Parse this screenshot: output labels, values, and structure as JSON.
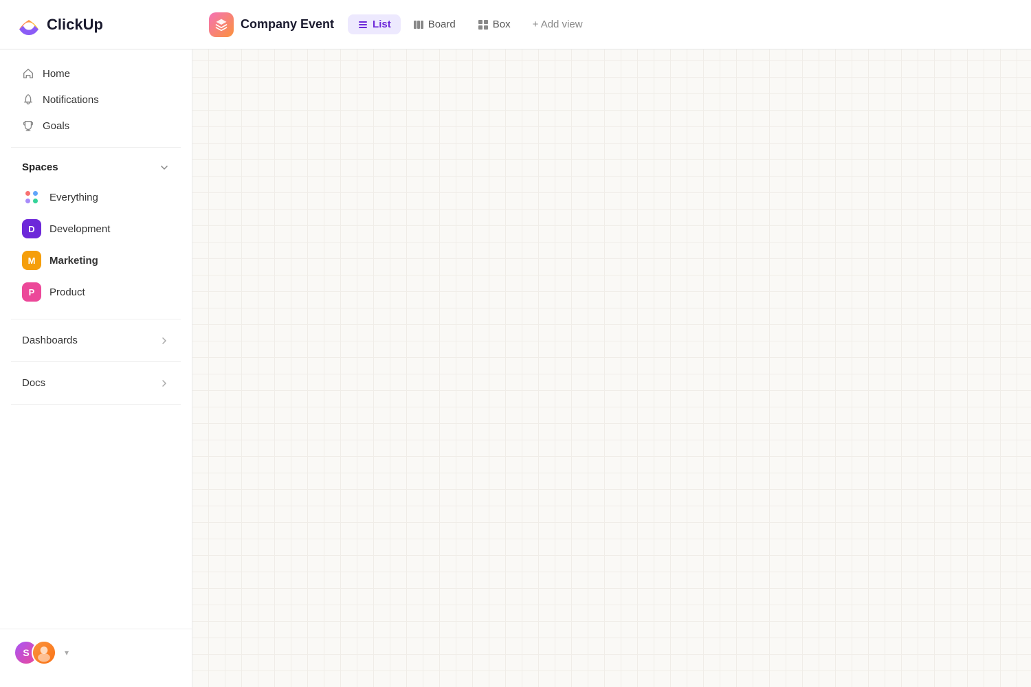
{
  "app": {
    "name": "ClickUp"
  },
  "header": {
    "project": {
      "name": "Company Event"
    },
    "views": [
      {
        "id": "list",
        "label": "List",
        "active": true
      },
      {
        "id": "board",
        "label": "Board",
        "active": false
      },
      {
        "id": "box",
        "label": "Box",
        "active": false
      }
    ],
    "add_view_label": "+ Add view"
  },
  "sidebar": {
    "nav": [
      {
        "id": "home",
        "label": "Home",
        "icon": "home-icon"
      },
      {
        "id": "notifications",
        "label": "Notifications",
        "icon": "bell-icon"
      },
      {
        "id": "goals",
        "label": "Goals",
        "icon": "trophy-icon"
      }
    ],
    "spaces_section": {
      "title": "Spaces",
      "items": [
        {
          "id": "everything",
          "label": "Everything",
          "type": "everything"
        },
        {
          "id": "development",
          "label": "Development",
          "type": "avatar",
          "letter": "D",
          "color": "#6d28d9"
        },
        {
          "id": "marketing",
          "label": "Marketing",
          "type": "avatar",
          "letter": "M",
          "color": "#f59e0b",
          "bold": true
        },
        {
          "id": "product",
          "label": "Product",
          "type": "avatar",
          "letter": "P",
          "color": "#ec4899"
        }
      ]
    },
    "expandables": [
      {
        "id": "dashboards",
        "label": "Dashboards"
      },
      {
        "id": "docs",
        "label": "Docs"
      }
    ],
    "user": {
      "initials": "S"
    }
  }
}
